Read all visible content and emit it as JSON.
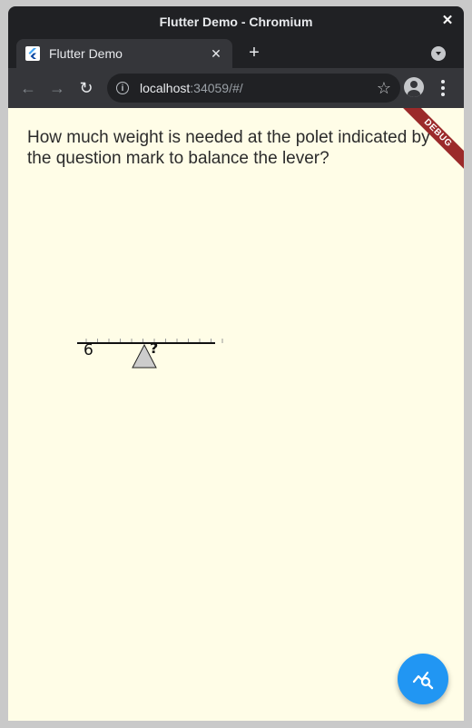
{
  "window": {
    "title": "Flutter Demo - Chromium",
    "close_glyph": "✕"
  },
  "tab": {
    "title": "Flutter Demo",
    "favicon": "flutter-icon",
    "close_glyph": "✕"
  },
  "new_tab_glyph": "+",
  "toolbar": {
    "url_host": "localhost",
    "url_rest": ":34059/#/",
    "back_glyph": "←",
    "forward_glyph": "→",
    "reload_glyph": "↻",
    "star_glyph": "☆",
    "info_glyph": "i"
  },
  "page": {
    "question": "How much weight is needed at the polet indicated by the question mark to balance the lever?",
    "debug_banner": "DEBUG",
    "lever": {
      "left_weight_label": "6",
      "unknown_label": "?",
      "tick_count": 13
    },
    "fab_icon": "analytics-search-icon"
  },
  "colors": {
    "page_background": "#fffde7",
    "fab": "#2196f3",
    "debug_ribbon": "#9b2a2a",
    "fulcrum_fill": "#cccccc"
  }
}
